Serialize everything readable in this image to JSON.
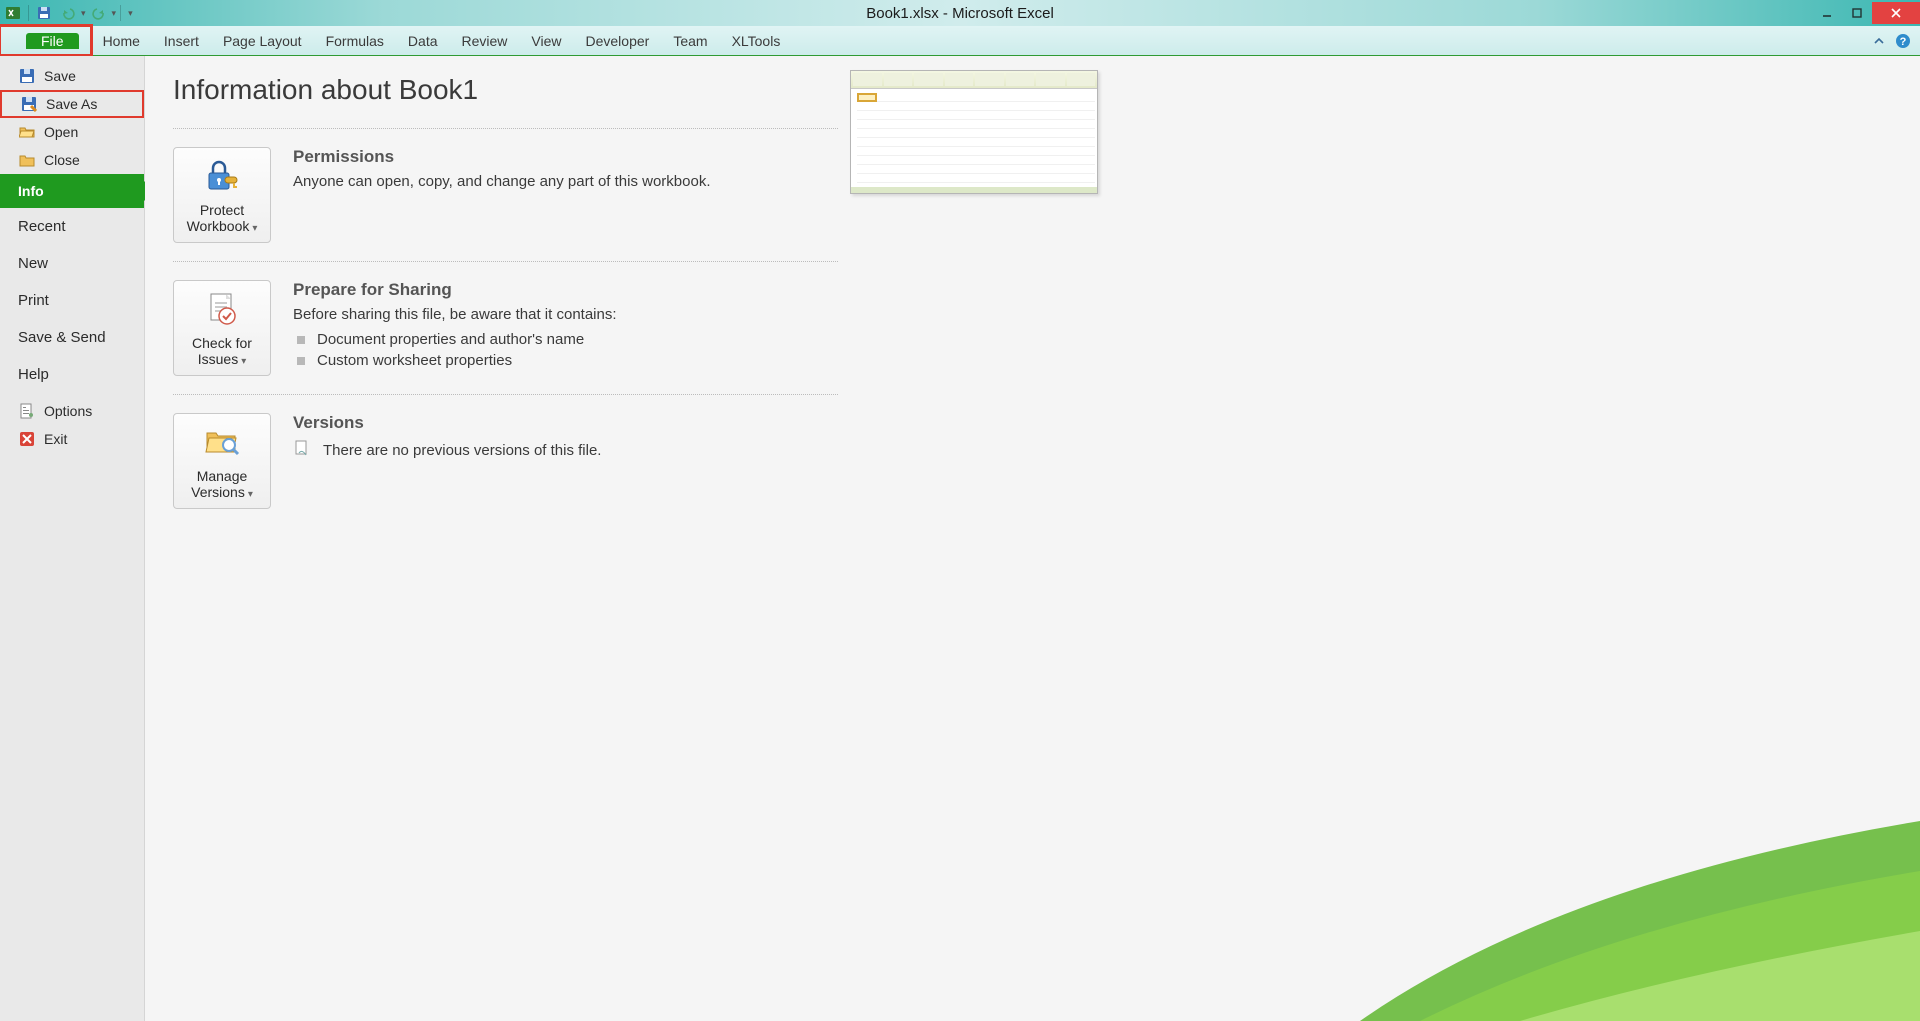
{
  "title": "Book1.xlsx - Microsoft Excel",
  "tabs": {
    "file": "File",
    "home": "Home",
    "insert": "Insert",
    "page_layout": "Page Layout",
    "formulas": "Formulas",
    "data": "Data",
    "review": "Review",
    "view": "View",
    "developer": "Developer",
    "team": "Team",
    "xltools": "XLTools"
  },
  "leftnav": {
    "save": "Save",
    "save_as": "Save As",
    "open": "Open",
    "close": "Close",
    "info": "Info",
    "recent": "Recent",
    "new": "New",
    "print": "Print",
    "save_send": "Save & Send",
    "help": "Help",
    "options": "Options",
    "exit": "Exit"
  },
  "content": {
    "heading": "Information about Book1",
    "permissions": {
      "title": "Permissions",
      "text": "Anyone can open, copy, and change any part of this workbook.",
      "button_l1": "Protect",
      "button_l2": "Workbook"
    },
    "prepare": {
      "title": "Prepare for Sharing",
      "text": "Before sharing this file, be aware that it contains:",
      "item1": "Document properties and author's name",
      "item2": "Custom worksheet properties",
      "button_l1": "Check for",
      "button_l2": "Issues"
    },
    "versions": {
      "title": "Versions",
      "text": "There are no previous versions of this file.",
      "button_l1": "Manage",
      "button_l2": "Versions"
    }
  }
}
